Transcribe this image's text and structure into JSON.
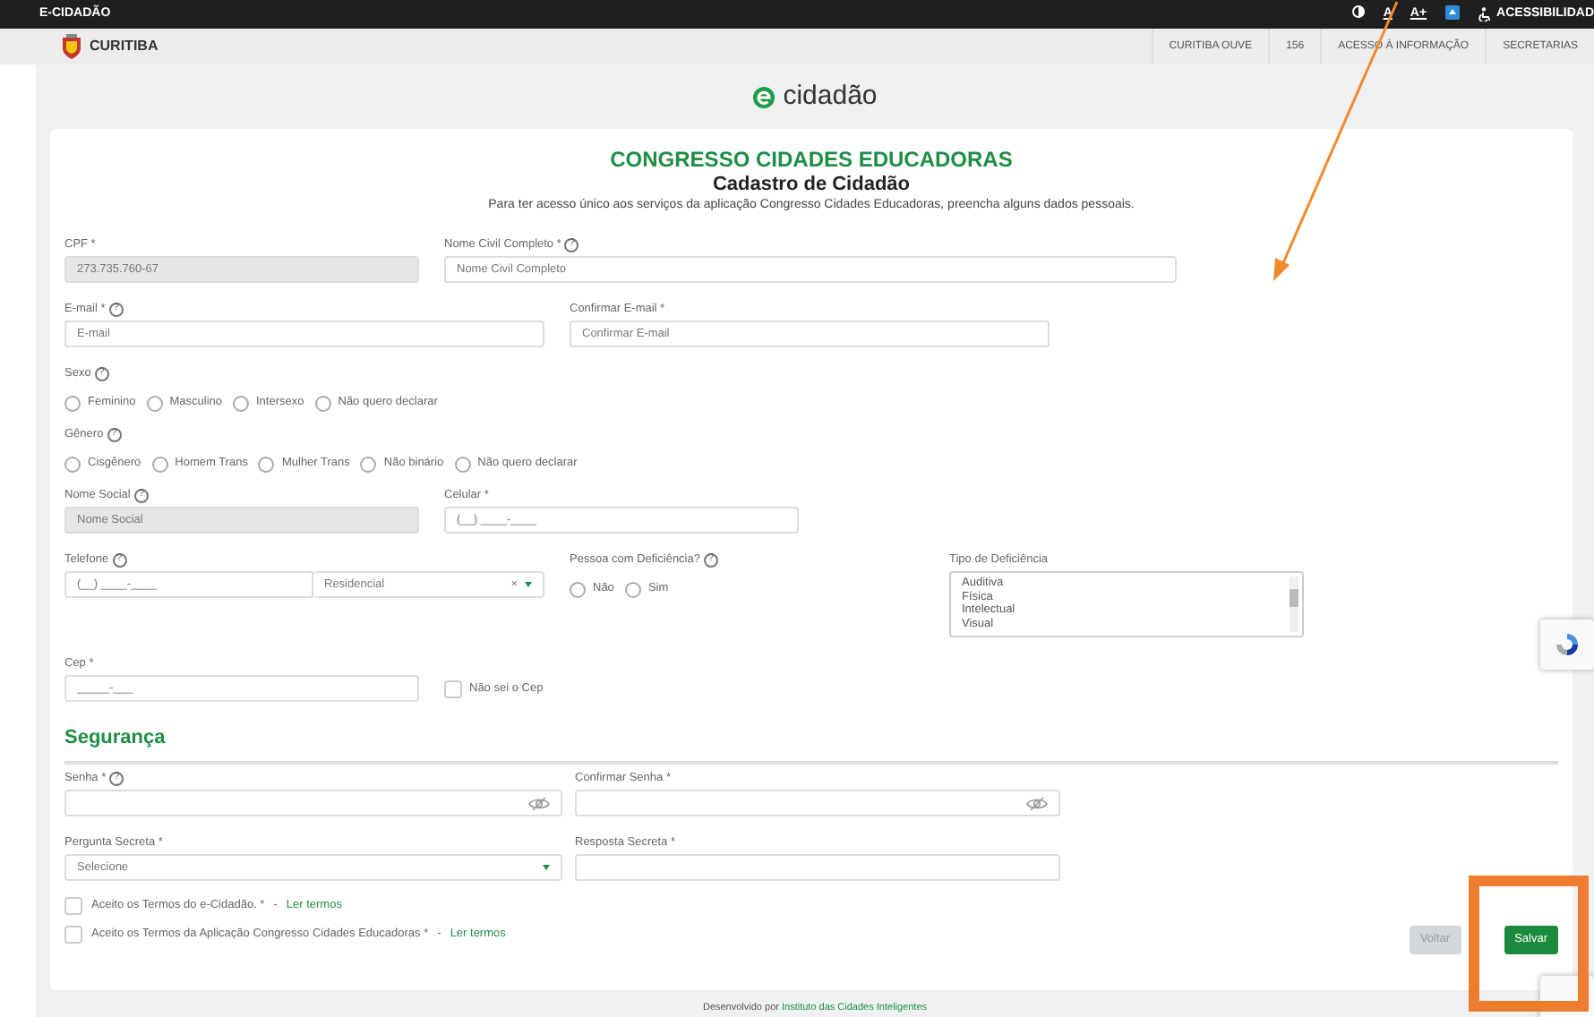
{
  "top_bar": {
    "title": "E-CIDADÃO",
    "tools": [
      {
        "kind": "contrast"
      },
      {
        "kind": "text",
        "label": "A"
      },
      {
        "kind": "text",
        "label": "A+"
      },
      {
        "kind": "badge"
      },
      {
        "kind": "accessibility",
        "label": "ACESSIBILIDAD"
      }
    ]
  },
  "header": {
    "brand": "CURITIBA",
    "nav": [
      "CURITIBA OUVE",
      "156",
      "ACESSO À INFORMAÇÃO",
      "SECRETARIAS"
    ]
  },
  "logo": {
    "text": "cidadão"
  },
  "form": {
    "title": "CONGRESSO CIDADES EDUCADORAS",
    "subtitle": "Cadastro de Cidadão",
    "description": "Para ter acesso único aos serviços da aplicação Congresso Cidades Educadoras, preencha alguns dados pessoais.",
    "rows": [
      [
        {
          "kind": "text",
          "label": "CPF *",
          "value": "273.735.760-67",
          "disabled": true
        },
        {
          "kind": "text",
          "label": "Nome Civil Completo *",
          "help": "?",
          "placeholder": "Nome Civil Completo",
          "disabled": false
        }
      ],
      [
        {
          "kind": "text",
          "label": "E-mail *",
          "help": "?",
          "placeholder": "E-mail",
          "disabled": false
        },
        {
          "kind": "text",
          "label": "Confirmar E-mail *",
          "placeholder": "Confirmar E-mail",
          "disabled": false
        }
      ],
      [
        {
          "kind": "radio",
          "label": "Sexo",
          "help": "?",
          "options": [
            {
              "label": "Feminino",
              "selected": false
            },
            {
              "label": "Masculino",
              "selected": false
            },
            {
              "label": "Intersexo",
              "selected": false
            },
            {
              "label": "Não quero declarar",
              "selected": false
            }
          ]
        }
      ],
      [
        {
          "kind": "radio",
          "label": "Gênero",
          "help": "?",
          "options": [
            {
              "label": "Cisgênero",
              "selected": false
            },
            {
              "label": "Homem Trans",
              "selected": false
            },
            {
              "label": "Mulher Trans",
              "selected": false
            },
            {
              "label": "Não binário",
              "selected": false
            },
            {
              "label": "Não quero declarar",
              "selected": false
            }
          ]
        }
      ],
      [
        {
          "kind": "text",
          "label": "Nome Social",
          "help": "?",
          "placeholder": "Nome Social",
          "disabled": true
        },
        {
          "kind": "text",
          "label": "Celular *",
          "placeholder": "(__) ____-____",
          "disabled": false
        }
      ],
      [
        {
          "kind": "phone",
          "label": "Telefone",
          "help": "?",
          "placeholder": "(__) ____-____",
          "type": "Residencial",
          "clear": "×"
        },
        {
          "kind": "radio",
          "label": "Pessoa com Deficiência?",
          "help": "?",
          "options": [
            {
              "label": "Não",
              "selected": false
            },
            {
              "label": "Sim",
              "selected": false
            }
          ]
        },
        {
          "kind": "listbox",
          "label": "Tipo de Deficiência",
          "items": [
            "Auditiva",
            "Física",
            "Intelectual",
            "Visual"
          ]
        }
      ],
      [
        {
          "kind": "text",
          "label": "Cep *",
          "placeholder": "_____-___",
          "disabled": false
        },
        {
          "kind": "checkbox",
          "label": "Não sei o Cep",
          "checked": false
        }
      ]
    ],
    "section": "Segurança",
    "security_rows": [
      [
        {
          "kind": "password",
          "label": "Senha *",
          "help": "?"
        },
        {
          "kind": "password",
          "label": "Confirmar Senha *"
        }
      ],
      [
        {
          "kind": "select",
          "label": "Pergunta Secreta *",
          "value": "Selecione"
        },
        {
          "kind": "text",
          "label": "Resposta Secreta *",
          "disabled": false
        }
      ]
    ],
    "terms": [
      {
        "label": "Aceito os Termos do e-Cidadão. *",
        "separator": "-",
        "link": "Ler termos",
        "checked": false
      },
      {
        "label": "Aceito os Termos da Aplicação Congresso Cidades Educadoras *",
        "separator": "-",
        "link": "Ler termos",
        "checked": false
      }
    ],
    "buttons": [
      {
        "label": "Voltar",
        "kind": "secondary"
      },
      {
        "label": "Salvar",
        "kind": "primary"
      }
    ]
  },
  "footer": {
    "text": "Desenvolvido por",
    "link": "Instituto das Cidades Inteligentes"
  }
}
